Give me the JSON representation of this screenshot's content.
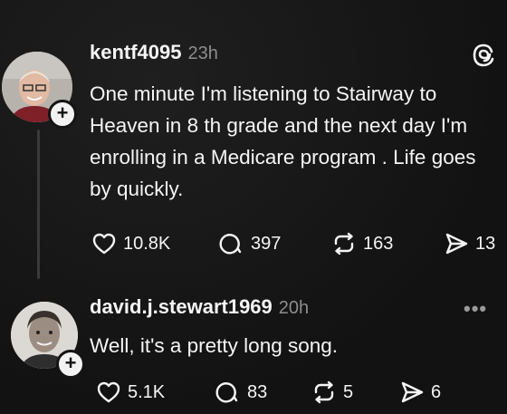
{
  "posts": [
    {
      "username": "kentf4095",
      "time": "23h",
      "text": "One minute I'm listening to Stairway to Heaven in 8 th grade and the next day I'm enrolling in a Medicare program . Life goes by quickly.",
      "likes": "10.8K",
      "replies": "397",
      "reposts": "163",
      "shares": "13"
    },
    {
      "username": "david.j.stewart1969",
      "time": "20h",
      "text": "Well, it's a pretty long song.",
      "likes": "5.1K",
      "replies": "83",
      "reposts": "5",
      "shares": "6"
    }
  ],
  "icons": {
    "like": "heart-icon",
    "reply": "comment-icon",
    "repost": "repost-icon",
    "share": "send-icon",
    "logo": "threads-logo-icon",
    "more": "more-icon",
    "follow": "plus-icon"
  },
  "colors": {
    "background": "#141414",
    "text": "#f5f5f5",
    "muted": "#8d8d8d"
  }
}
